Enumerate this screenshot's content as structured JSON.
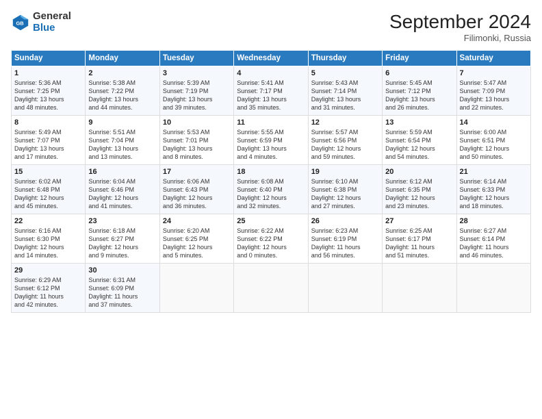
{
  "header": {
    "logo_general": "General",
    "logo_blue": "Blue",
    "title": "September 2024",
    "location": "Filimonki, Russia"
  },
  "days_of_week": [
    "Sunday",
    "Monday",
    "Tuesday",
    "Wednesday",
    "Thursday",
    "Friday",
    "Saturday"
  ],
  "weeks": [
    [
      {
        "day": "1",
        "lines": [
          "Sunrise: 5:36 AM",
          "Sunset: 7:25 PM",
          "Daylight: 13 hours",
          "and 48 minutes."
        ]
      },
      {
        "day": "2",
        "lines": [
          "Sunrise: 5:38 AM",
          "Sunset: 7:22 PM",
          "Daylight: 13 hours",
          "and 44 minutes."
        ]
      },
      {
        "day": "3",
        "lines": [
          "Sunrise: 5:39 AM",
          "Sunset: 7:19 PM",
          "Daylight: 13 hours",
          "and 39 minutes."
        ]
      },
      {
        "day": "4",
        "lines": [
          "Sunrise: 5:41 AM",
          "Sunset: 7:17 PM",
          "Daylight: 13 hours",
          "and 35 minutes."
        ]
      },
      {
        "day": "5",
        "lines": [
          "Sunrise: 5:43 AM",
          "Sunset: 7:14 PM",
          "Daylight: 13 hours",
          "and 31 minutes."
        ]
      },
      {
        "day": "6",
        "lines": [
          "Sunrise: 5:45 AM",
          "Sunset: 7:12 PM",
          "Daylight: 13 hours",
          "and 26 minutes."
        ]
      },
      {
        "day": "7",
        "lines": [
          "Sunrise: 5:47 AM",
          "Sunset: 7:09 PM",
          "Daylight: 13 hours",
          "and 22 minutes."
        ]
      }
    ],
    [
      {
        "day": "8",
        "lines": [
          "Sunrise: 5:49 AM",
          "Sunset: 7:07 PM",
          "Daylight: 13 hours",
          "and 17 minutes."
        ]
      },
      {
        "day": "9",
        "lines": [
          "Sunrise: 5:51 AM",
          "Sunset: 7:04 PM",
          "Daylight: 13 hours",
          "and 13 minutes."
        ]
      },
      {
        "day": "10",
        "lines": [
          "Sunrise: 5:53 AM",
          "Sunset: 7:01 PM",
          "Daylight: 13 hours",
          "and 8 minutes."
        ]
      },
      {
        "day": "11",
        "lines": [
          "Sunrise: 5:55 AM",
          "Sunset: 6:59 PM",
          "Daylight: 13 hours",
          "and 4 minutes."
        ]
      },
      {
        "day": "12",
        "lines": [
          "Sunrise: 5:57 AM",
          "Sunset: 6:56 PM",
          "Daylight: 12 hours",
          "and 59 minutes."
        ]
      },
      {
        "day": "13",
        "lines": [
          "Sunrise: 5:59 AM",
          "Sunset: 6:54 PM",
          "Daylight: 12 hours",
          "and 54 minutes."
        ]
      },
      {
        "day": "14",
        "lines": [
          "Sunrise: 6:00 AM",
          "Sunset: 6:51 PM",
          "Daylight: 12 hours",
          "and 50 minutes."
        ]
      }
    ],
    [
      {
        "day": "15",
        "lines": [
          "Sunrise: 6:02 AM",
          "Sunset: 6:48 PM",
          "Daylight: 12 hours",
          "and 45 minutes."
        ]
      },
      {
        "day": "16",
        "lines": [
          "Sunrise: 6:04 AM",
          "Sunset: 6:46 PM",
          "Daylight: 12 hours",
          "and 41 minutes."
        ]
      },
      {
        "day": "17",
        "lines": [
          "Sunrise: 6:06 AM",
          "Sunset: 6:43 PM",
          "Daylight: 12 hours",
          "and 36 minutes."
        ]
      },
      {
        "day": "18",
        "lines": [
          "Sunrise: 6:08 AM",
          "Sunset: 6:40 PM",
          "Daylight: 12 hours",
          "and 32 minutes."
        ]
      },
      {
        "day": "19",
        "lines": [
          "Sunrise: 6:10 AM",
          "Sunset: 6:38 PM",
          "Daylight: 12 hours",
          "and 27 minutes."
        ]
      },
      {
        "day": "20",
        "lines": [
          "Sunrise: 6:12 AM",
          "Sunset: 6:35 PM",
          "Daylight: 12 hours",
          "and 23 minutes."
        ]
      },
      {
        "day": "21",
        "lines": [
          "Sunrise: 6:14 AM",
          "Sunset: 6:33 PM",
          "Daylight: 12 hours",
          "and 18 minutes."
        ]
      }
    ],
    [
      {
        "day": "22",
        "lines": [
          "Sunrise: 6:16 AM",
          "Sunset: 6:30 PM",
          "Daylight: 12 hours",
          "and 14 minutes."
        ]
      },
      {
        "day": "23",
        "lines": [
          "Sunrise: 6:18 AM",
          "Sunset: 6:27 PM",
          "Daylight: 12 hours",
          "and 9 minutes."
        ]
      },
      {
        "day": "24",
        "lines": [
          "Sunrise: 6:20 AM",
          "Sunset: 6:25 PM",
          "Daylight: 12 hours",
          "and 5 minutes."
        ]
      },
      {
        "day": "25",
        "lines": [
          "Sunrise: 6:22 AM",
          "Sunset: 6:22 PM",
          "Daylight: 12 hours",
          "and 0 minutes."
        ]
      },
      {
        "day": "26",
        "lines": [
          "Sunrise: 6:23 AM",
          "Sunset: 6:19 PM",
          "Daylight: 11 hours",
          "and 56 minutes."
        ]
      },
      {
        "day": "27",
        "lines": [
          "Sunrise: 6:25 AM",
          "Sunset: 6:17 PM",
          "Daylight: 11 hours",
          "and 51 minutes."
        ]
      },
      {
        "day": "28",
        "lines": [
          "Sunrise: 6:27 AM",
          "Sunset: 6:14 PM",
          "Daylight: 11 hours",
          "and 46 minutes."
        ]
      }
    ],
    [
      {
        "day": "29",
        "lines": [
          "Sunrise: 6:29 AM",
          "Sunset: 6:12 PM",
          "Daylight: 11 hours",
          "and 42 minutes."
        ]
      },
      {
        "day": "30",
        "lines": [
          "Sunrise: 6:31 AM",
          "Sunset: 6:09 PM",
          "Daylight: 11 hours",
          "and 37 minutes."
        ]
      },
      {
        "day": "",
        "lines": []
      },
      {
        "day": "",
        "lines": []
      },
      {
        "day": "",
        "lines": []
      },
      {
        "day": "",
        "lines": []
      },
      {
        "day": "",
        "lines": []
      }
    ]
  ]
}
